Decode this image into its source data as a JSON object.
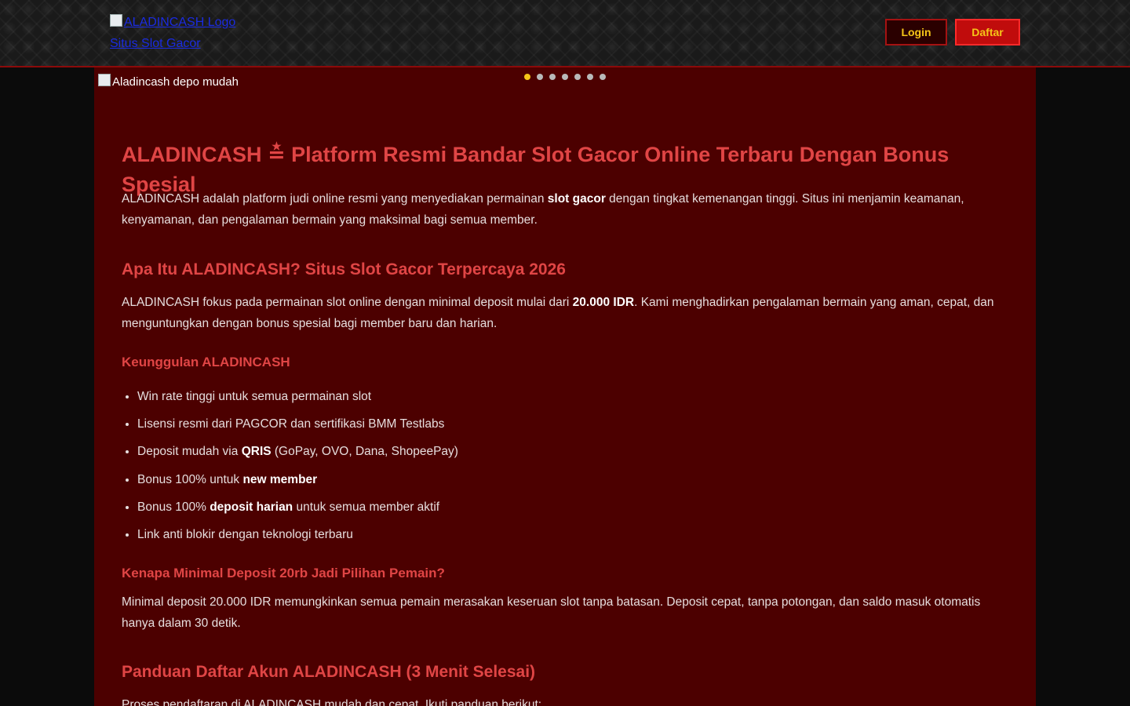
{
  "header": {
    "logo_alt": "ALADINCASH Logo Situs Slot Gacor",
    "login_label": "Login",
    "daftar_label": "Daftar"
  },
  "banner": {
    "alt": "Aladincash depo mudah",
    "slide_count": 7,
    "active_slide": 1
  },
  "article": {
    "h1": "ALADINCASH ≛ Platform Resmi Bandar Slot Gacor Online Terbaru Dengan Bonus Spesial",
    "intro": {
      "pre": "ALADINCASH adalah platform judi online resmi yang menyediakan permainan ",
      "bold": "slot gacor",
      "post": " dengan tingkat kemenangan tinggi. Situs ini menjamin keamanan, kenyamanan, dan pengalaman bermain yang maksimal bagi semua member."
    },
    "h2_about": "Apa Itu ALADINCASH? Situs Slot Gacor Terpercaya 2026",
    "about": {
      "pre": "ALADINCASH fokus pada permainan slot online dengan minimal deposit mulai dari ",
      "bold": "20.000 IDR",
      "post": ". Kami menghadirkan pengalaman bermain yang aman, cepat, dan menguntungkan dengan bonus spesial bagi member baru dan harian."
    },
    "h3_advantages": "Keunggulan ALADINCASH",
    "advantages": [
      {
        "pre": "Win rate tinggi untuk semua permainan slot",
        "bold": "",
        "post": ""
      },
      {
        "pre": "Lisensi resmi dari PAGCOR dan sertifikasi BMM Testlabs",
        "bold": "",
        "post": ""
      },
      {
        "pre": "Deposit mudah via ",
        "bold": "QRIS",
        "post": " (GoPay, OVO, Dana, ShopeePay)"
      },
      {
        "pre": "Bonus 100% untuk ",
        "bold": "new member",
        "post": ""
      },
      {
        "pre": "Bonus 100% ",
        "bold": "deposit harian",
        "post": " untuk semua member aktif"
      },
      {
        "pre": "Link anti blokir dengan teknologi terbaru",
        "bold": "",
        "post": ""
      }
    ],
    "h3_min_deposit": "Kenapa Minimal Deposit 20rb Jadi Pilihan Pemain?",
    "min_deposit": "Minimal deposit 20.000 IDR memungkinkan semua pemain merasakan keseruan slot tanpa batasan. Deposit cepat, tanpa potongan, dan saldo masuk otomatis hanya dalam 30 detik.",
    "h2_register": "Panduan Daftar Akun ALADINCASH (3 Menit Selesai)",
    "register_intro": "Proses pendaftaran di ALADINCASH mudah dan cepat. Ikuti panduan berikut:"
  }
}
